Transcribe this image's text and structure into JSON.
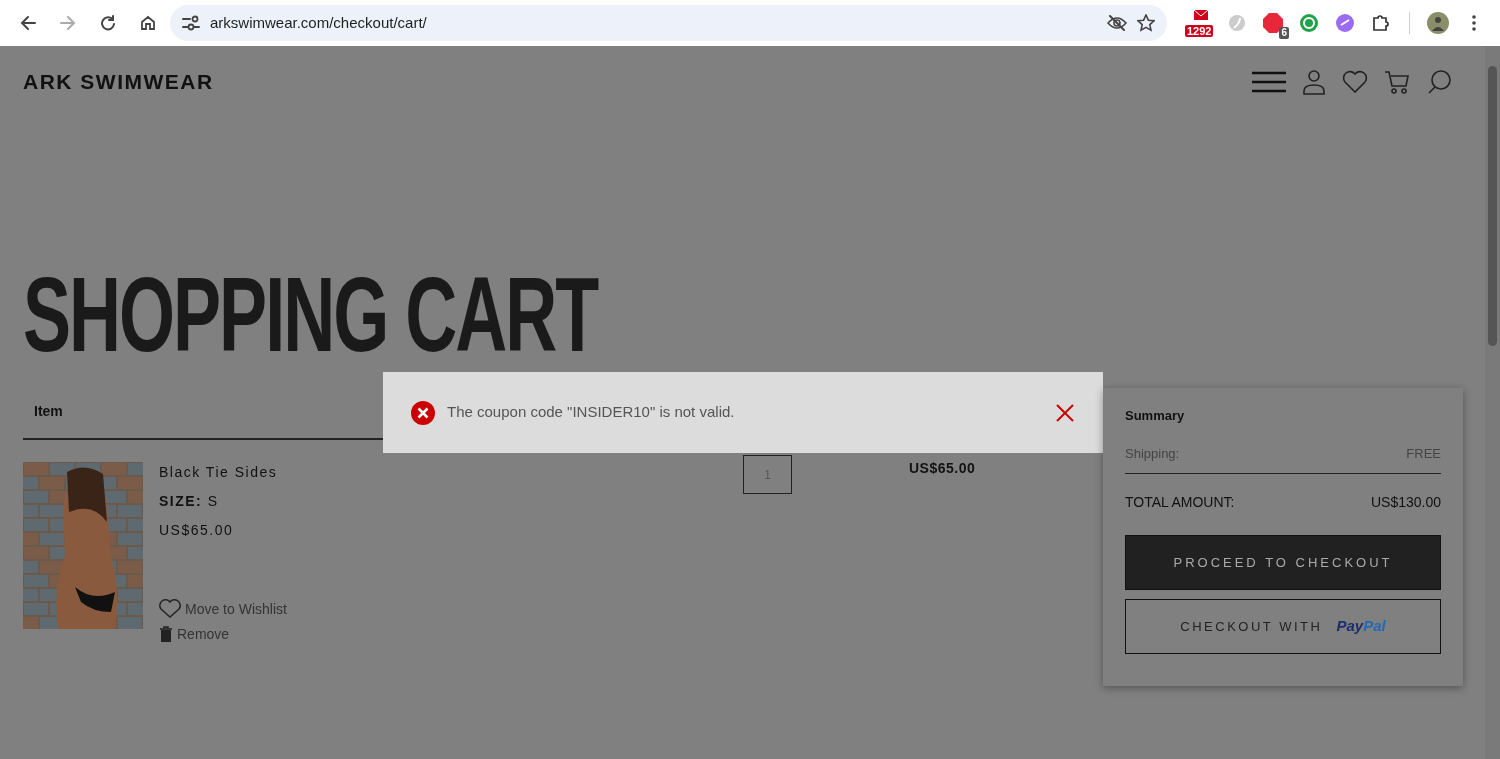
{
  "browser": {
    "url": "arkswimwear.com/checkout/cart/",
    "mail_badge": "1292",
    "adblock_badge": "6"
  },
  "site": {
    "logo": "ARK SWIMWEAR"
  },
  "page_title": "SHOPPING CART",
  "table": {
    "column_1": "Item"
  },
  "item": {
    "name": "Black Tie Sides",
    "size_label": "SIZE:",
    "size": "S",
    "price": "US$65.00",
    "quantity": "1",
    "line_total": "US$65.00",
    "actions": [
      {
        "kind": "wishlist",
        "label": "Move to Wishlist"
      },
      {
        "kind": "remove",
        "label": "Remove"
      }
    ]
  },
  "alert": {
    "message": "The coupon code \"INSIDER10\" is not valid."
  },
  "summary": {
    "title": "Summary",
    "shipping_label": "Shipping:",
    "shipping_value": "FREE",
    "total_label": "TOTAL AMOUNT:",
    "total_value": "US$130.00",
    "checkout_button": "PROCEED TO CHECKOUT",
    "paypal_button": "CHECKOUT WITH",
    "paypal_logo": [
      "Pay",
      "Pal"
    ]
  }
}
